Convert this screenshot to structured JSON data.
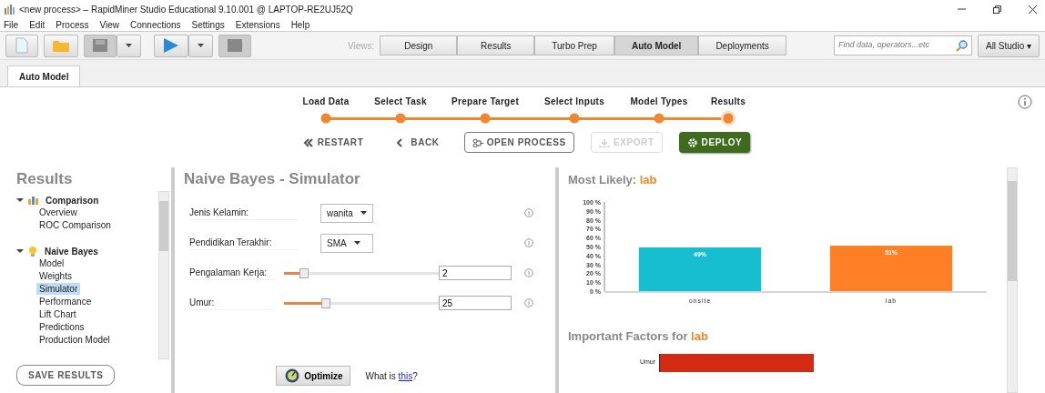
{
  "window": {
    "title": "<new process> – RapidMiner Studio Educational 9.10.001 @ LAPTOP-RE2UJ52Q"
  },
  "menu": [
    "File",
    "Edit",
    "Process",
    "View",
    "Connections",
    "Settings",
    "Extensions",
    "Help"
  ],
  "toolbar": {
    "views_label": "Views:",
    "views": [
      {
        "label": "Design",
        "selected": false
      },
      {
        "label": "Results",
        "selected": false
      },
      {
        "label": "Turbo Prep",
        "selected": false
      },
      {
        "label": "Auto Model",
        "selected": true
      },
      {
        "label": "Deployments",
        "selected": false
      }
    ],
    "search": {
      "placeholder": "Find data, operators...etc"
    },
    "scope": "All Studio ▾"
  },
  "tabs": [
    {
      "label": "Auto Model",
      "selected": true
    }
  ],
  "wizard": {
    "steps": [
      {
        "label": "Load Data",
        "selected": false
      },
      {
        "label": "Select Task",
        "selected": false
      },
      {
        "label": "Prepare Target",
        "selected": false
      },
      {
        "label": "Select Inputs",
        "selected": false
      },
      {
        "label": "Model Types",
        "selected": false
      },
      {
        "label": "Results",
        "selected": true
      }
    ],
    "buttons": [
      {
        "kind": "restart",
        "label": "RESTART",
        "disabled": false
      },
      {
        "kind": "back",
        "label": "BACK",
        "disabled": false
      },
      {
        "kind": "open",
        "label": "OPEN PROCESS",
        "disabled": false
      },
      {
        "kind": "export",
        "label": "EXPORT",
        "disabled": true
      },
      {
        "kind": "deploy",
        "label": "DEPLOY",
        "disabled": false
      }
    ]
  },
  "sidebar": {
    "title": "Results",
    "items": [
      {
        "label": "Comparison",
        "kind": "comparison",
        "expanded": true,
        "selected": false,
        "children": [
          {
            "label": "Overview",
            "selected": false
          },
          {
            "label": "ROC Comparison",
            "selected": false
          }
        ]
      },
      {
        "label": "Naive Bayes",
        "kind": "model",
        "expanded": true,
        "selected": false,
        "children": [
          {
            "label": "Model",
            "selected": false
          },
          {
            "label": "Weights",
            "selected": false
          },
          {
            "label": "Simulator",
            "selected": true
          },
          {
            "label": "Performance",
            "selected": false
          },
          {
            "label": "Lift Chart",
            "selected": false
          },
          {
            "label": "Predictions",
            "selected": false
          },
          {
            "label": "Production Model",
            "selected": false
          }
        ]
      }
    ],
    "save_button": "SAVE RESULTS"
  },
  "simulator": {
    "title": "Naive Bayes - Simulator",
    "inputs": [
      {
        "kind": "select",
        "label": "Jenis Kelamin:",
        "value": "wanita"
      },
      {
        "kind": "select",
        "label": "Pendidikan Terakhir:",
        "value": "SMA"
      },
      {
        "kind": "slider",
        "label": "Pengalaman Kerja:",
        "level": 0.13,
        "value": "2"
      },
      {
        "kind": "slider",
        "label": "Umur:",
        "level": 0.27,
        "value": "25"
      }
    ],
    "optimize_button": "Optimize",
    "help": {
      "prefix": "What is",
      "link": "this",
      "suffix": "?"
    }
  },
  "prediction": {
    "title": "Most Likely: **lab**",
    "chart_data": {
      "type": "bar",
      "categories": [
        "onsite",
        "lab"
      ],
      "values": [
        49,
        51
      ],
      "colors": [
        "#17becf",
        "#ff7f27"
      ],
      "ylim": [
        0,
        100
      ],
      "yticks": [
        {
          "value": 0,
          "label": "0 %"
        },
        {
          "value": 10,
          "label": "10 %"
        },
        {
          "value": 20,
          "label": "20 %"
        },
        {
          "value": 30,
          "label": "30 %"
        },
        {
          "value": 40,
          "label": "40 %"
        },
        {
          "value": 50,
          "label": "50 %"
        },
        {
          "value": 60,
          "label": "60 %"
        },
        {
          "value": 70,
          "label": "70 %"
        },
        {
          "value": 80,
          "label": "80 %"
        },
        {
          "value": 90,
          "label": "90 %"
        },
        {
          "value": 100,
          "label": "100 %"
        }
      ],
      "value_labels": [
        "49%",
        "51%"
      ]
    },
    "factors_title": "Important Factors for **lab**",
    "factors": [
      {
        "label": "Umur"
      }
    ]
  }
}
